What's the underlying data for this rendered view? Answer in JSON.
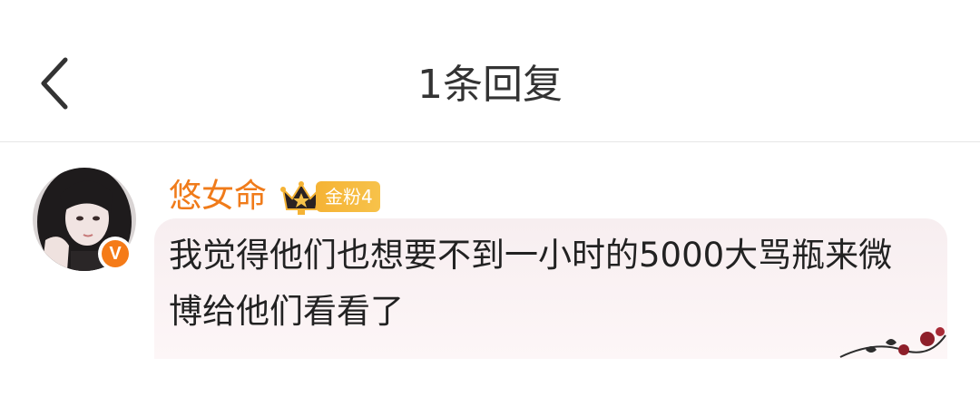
{
  "header": {
    "title": "1条回复"
  },
  "comment": {
    "username": "悠女命",
    "fan_badge": {
      "label": "金粉",
      "level": "4"
    },
    "verified_mark": "V",
    "content": "我觉得他们也想要不到一小时的5000大骂瓶来微博给他们看看了"
  },
  "colors": {
    "username": "#f07b1a",
    "badge": "#f5b335",
    "verified": "#f57b18",
    "bubble_bg": "#f7eef0"
  }
}
